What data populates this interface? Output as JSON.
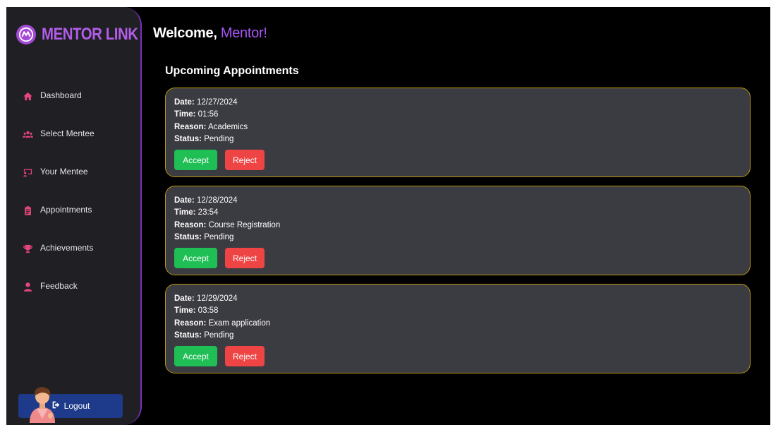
{
  "brand": {
    "name": "MENTOR LINK"
  },
  "sidebar": {
    "items": [
      {
        "label": "Dashboard",
        "icon": "home-icon"
      },
      {
        "label": "Select Mentee",
        "icon": "users-icon"
      },
      {
        "label": "Your Mentee",
        "icon": "chalkboard-icon"
      },
      {
        "label": "Appointments",
        "icon": "clipboard-icon"
      },
      {
        "label": "Achievements",
        "icon": "trophy-icon"
      },
      {
        "label": "Feedback",
        "icon": "user-icon"
      }
    ],
    "logout_label": "Logout"
  },
  "header": {
    "welcome": "Welcome,",
    "role": "Mentor!"
  },
  "main": {
    "section_title": "Upcoming Appointments",
    "field_labels": {
      "date": "Date:",
      "time": "Time:",
      "reason": "Reason:",
      "status": "Status:"
    },
    "accept_label": "Accept",
    "reject_label": "Reject",
    "appointments": [
      {
        "date": "12/27/2024",
        "time": "01:56",
        "reason": "Academics",
        "status": "Pending"
      },
      {
        "date": "12/28/2024",
        "time": "23:54",
        "reason": "Course Registration",
        "status": "Pending"
      },
      {
        "date": "12/29/2024",
        "time": "03:58",
        "reason": "Exam application",
        "status": "Pending"
      }
    ]
  },
  "colors": {
    "accent_purple": "#a855f7",
    "nav_icon": "#e8457a",
    "card_border": "#b8960c",
    "accept": "#1fbf55",
    "reject": "#ef4444",
    "logout": "#1e3a8a"
  }
}
